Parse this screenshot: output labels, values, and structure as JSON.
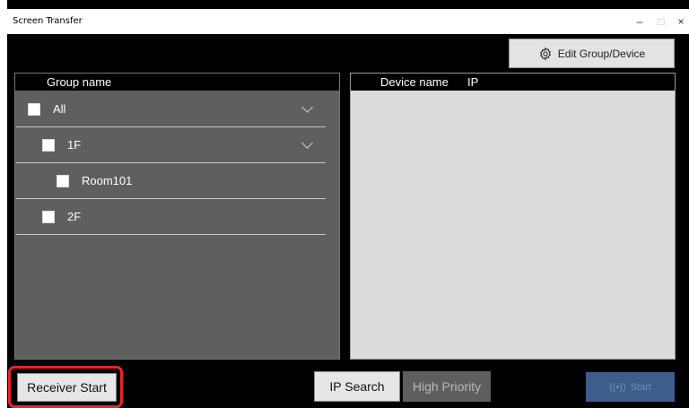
{
  "window": {
    "title": "Screen Transfer",
    "controls": {
      "minimize": "–",
      "maximize": "□",
      "close": "×"
    }
  },
  "toolbar": {
    "edit_group_device_label": "Edit Group/Device",
    "edit_icon": "gear-icon"
  },
  "group_panel": {
    "header": "Group name",
    "items": [
      {
        "label": "All",
        "checked": false,
        "expandable": true
      },
      {
        "label": "1F",
        "checked": false,
        "expandable": true
      },
      {
        "label": "Room101",
        "checked": false,
        "expandable": false
      },
      {
        "label": "2F",
        "checked": false,
        "expandable": false
      }
    ]
  },
  "device_panel": {
    "header_device": "Device name",
    "header_ip": "IP"
  },
  "buttons": {
    "receiver_start": "Receiver Start",
    "ip_search": "IP Search",
    "high_priority": "High Priority",
    "start": "Start",
    "start_icon": "broadcast-icon"
  },
  "colors": {
    "highlight": "#e8262a",
    "start_button": "#3b5e8c",
    "panel": "#5f5f5f",
    "device_area": "#dcdcdc"
  }
}
